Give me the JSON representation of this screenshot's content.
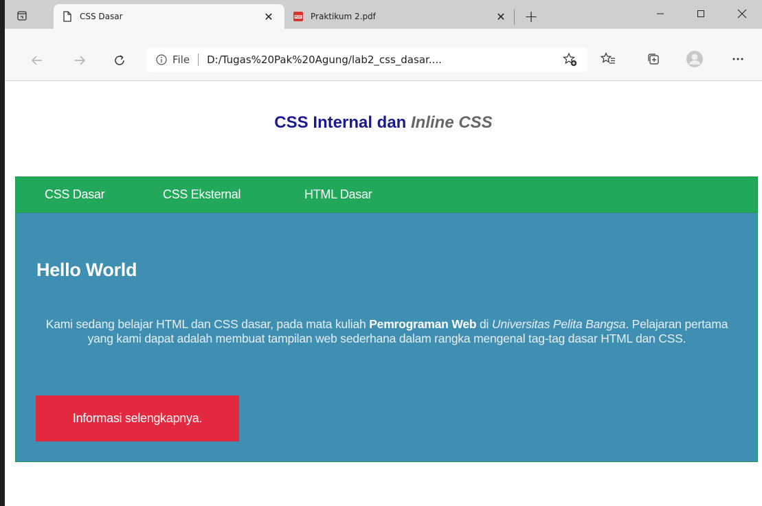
{
  "browser": {
    "tabs": [
      {
        "title": "CSS Dasar",
        "icon": "page-icon"
      },
      {
        "title": "Praktikum 2.pdf",
        "icon": "pdf-icon"
      }
    ],
    "address": {
      "scheme_label": "File",
      "url": "D:/Tugas%20Pak%20Agung/lab2_css_dasar...."
    },
    "pdf_badge": "PDF"
  },
  "page": {
    "heading_part1": "CSS Internal dan ",
    "heading_part2": "Inline CSS",
    "nav": [
      "CSS Dasar",
      "CSS Eksternal",
      "HTML Dasar"
    ],
    "hero": {
      "title": "Hello World",
      "text_1": "Kami sedang belajar HTML dan CSS dasar, pada mata kuliah ",
      "text_bold": "Pemrograman Web",
      "text_2": " di ",
      "text_italic": "Universitas Pelita Bangsa",
      "text_3": ". Pelajaran pertama yang kami dapat adalah membuat tampilan web sederhana dalam rangka mengenal tag-tag dasar HTML dan CSS.",
      "button_label": "Informasi selengkapnya."
    }
  },
  "colors": {
    "nav_bg": "#22a85a",
    "hero_bg": "#3f8fb2",
    "button_bg": "#e2293f",
    "heading": "#1a1a8f",
    "heading_italic": "#666666"
  }
}
